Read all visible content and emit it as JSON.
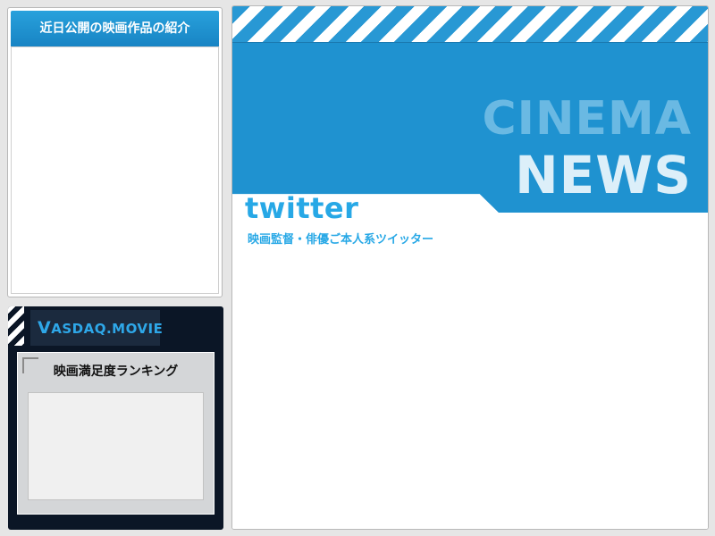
{
  "upcoming": {
    "title": "近日公開の映画作品の紹介"
  },
  "vasdaq": {
    "logo_initial": "V",
    "logo_rest": "ASDAQ.MOVIE",
    "ranking_title": "映画満足度ランキング"
  },
  "cinema_news": {
    "line1": "CINEMA",
    "line2": "NEWS"
  },
  "twitter": {
    "logo": "twitter",
    "subtitle": "映画監督・俳優ご本人系ツイッター"
  },
  "colors": {
    "accent_blue": "#1f92d0",
    "twitter_blue": "#27a8e6",
    "dark_navy": "#0b1626"
  }
}
